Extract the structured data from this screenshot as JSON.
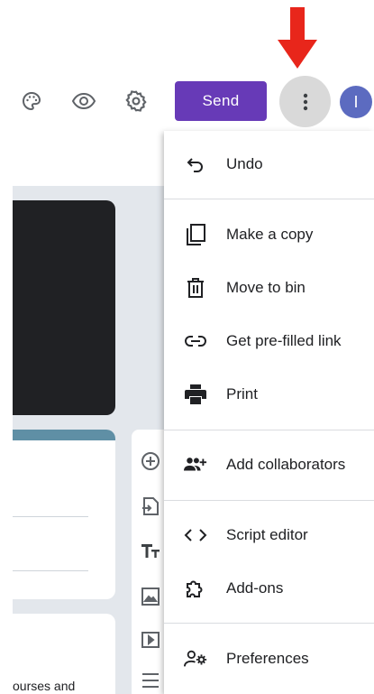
{
  "toolbar": {
    "icons": [
      "palette-icon",
      "eye-icon",
      "gear-icon"
    ],
    "send_label": "Send",
    "more_icon": "more-vertical-icon",
    "avatar_initial": "I"
  },
  "annotation": {
    "arrow_color": "#e8261b",
    "points_to": "more-options-button"
  },
  "menu": {
    "items": [
      {
        "label": "Undo",
        "icon": "undo-icon"
      },
      {
        "label": "Make a copy",
        "icon": "copy-icon"
      },
      {
        "label": "Move to bin",
        "icon": "trash-icon"
      },
      {
        "label": "Get pre-filled link",
        "icon": "link-icon"
      },
      {
        "label": "Print",
        "icon": "print-icon"
      },
      {
        "label": "Add collaborators",
        "icon": "add-people-icon"
      },
      {
        "label": "Script editor",
        "icon": "code-icon"
      },
      {
        "label": "Add-ons",
        "icon": "puzzle-icon"
      },
      {
        "label": "Preferences",
        "icon": "person-settings-icon"
      }
    ]
  },
  "form": {
    "snippet_text": "ourses and"
  },
  "side_tools": [
    "add-question-icon",
    "import-questions-icon",
    "title-text-icon",
    "image-icon",
    "video-icon",
    "section-icon"
  ],
  "colors": {
    "accent": "#673ab7",
    "avatar": "#5c6bc0",
    "form_background": "#e3e7ec",
    "menu_text": "#202124"
  }
}
